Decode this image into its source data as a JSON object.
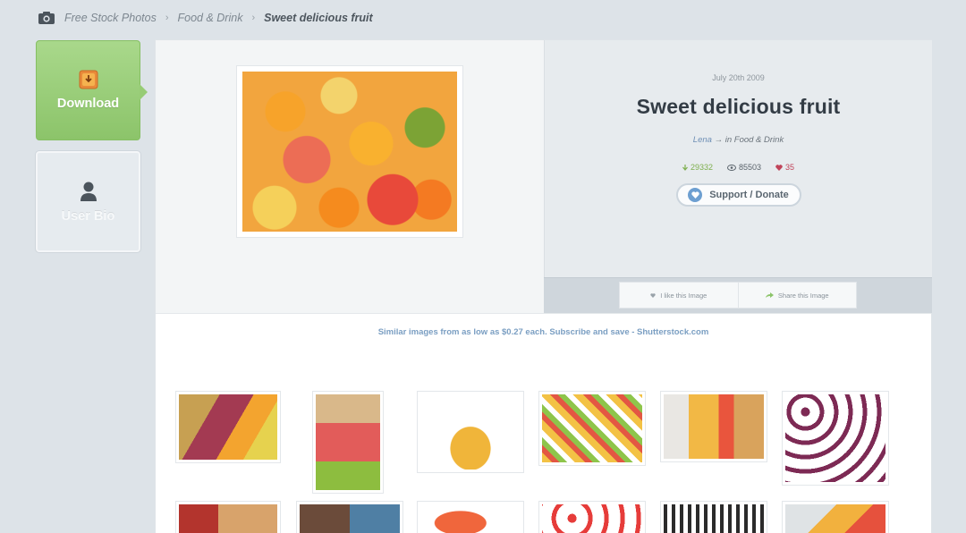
{
  "breadcrumb": {
    "items": [
      "Free Stock Photos",
      "Food & Drink"
    ],
    "current": "Sweet delicious fruit"
  },
  "sidebar": {
    "download_label": "Download",
    "bio_label": "User Bio"
  },
  "photo": {
    "date": "July 20th 2009",
    "title": "Sweet delicious fruit",
    "author": "Lena",
    "in_text": "→ in",
    "category": "Food & Drink",
    "stats": {
      "downloads": "29332",
      "views": "85503",
      "likes": "35"
    },
    "support_label": "Support / Donate",
    "like_label": "I like this Image",
    "share_label": "Share this Image"
  },
  "similar": {
    "banner": "Similar images from as low as $0.27 each. Subscribe and save - Shutterstock.com"
  },
  "colors": {
    "accent_green": "#8cc46a",
    "link_blue": "#7a9ec2",
    "heart_red": "#c0445a"
  }
}
